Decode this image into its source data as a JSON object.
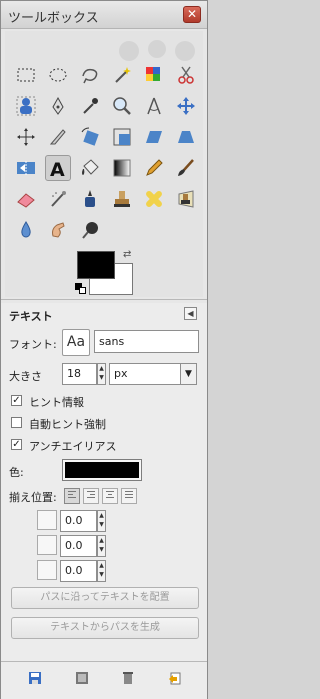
{
  "window": {
    "title": "ツールボックス",
    "close_icon": "close-icon"
  },
  "toolbox": {
    "tools": [
      {
        "name": "rect-select-tool",
        "icon": "rect-select-icon"
      },
      {
        "name": "ellipse-select-tool",
        "icon": "ellipse-select-icon"
      },
      {
        "name": "free-select-tool",
        "icon": "lasso-icon"
      },
      {
        "name": "fuzzy-select-tool",
        "icon": "magic-wand-icon"
      },
      {
        "name": "by-color-select-tool",
        "icon": "color-select-icon"
      },
      {
        "name": "scissors-select-tool",
        "icon": "scissors-icon"
      },
      {
        "name": "foreground-select-tool",
        "icon": "foreground-select-icon"
      },
      {
        "name": "paths-tool",
        "icon": "pen-path-icon"
      },
      {
        "name": "color-picker-tool",
        "icon": "eyedropper-icon"
      },
      {
        "name": "zoom-tool",
        "icon": "magnifier-icon"
      },
      {
        "name": "measure-tool",
        "icon": "compass-icon"
      },
      {
        "name": "move-tool",
        "icon": "move-arrows-icon"
      },
      {
        "name": "align-tool",
        "icon": "align-icon"
      },
      {
        "name": "crop-tool",
        "icon": "crop-knife-icon"
      },
      {
        "name": "rotate-tool",
        "icon": "rotate-icon"
      },
      {
        "name": "scale-tool",
        "icon": "scale-icon"
      },
      {
        "name": "shear-tool",
        "icon": "shear-icon"
      },
      {
        "name": "perspective-tool",
        "icon": "perspective-icon"
      },
      {
        "name": "flip-tool",
        "icon": "flip-icon"
      },
      {
        "name": "text-tool",
        "icon": "text-a-icon"
      },
      {
        "name": "bucket-fill-tool",
        "icon": "bucket-icon"
      },
      {
        "name": "blend-tool",
        "icon": "gradient-icon"
      },
      {
        "name": "pencil-tool",
        "icon": "pencil-icon"
      },
      {
        "name": "paintbrush-tool",
        "icon": "brush-icon"
      },
      {
        "name": "eraser-tool",
        "icon": "eraser-icon"
      },
      {
        "name": "airbrush-tool",
        "icon": "airbrush-icon"
      },
      {
        "name": "ink-tool",
        "icon": "ink-icon"
      },
      {
        "name": "clone-tool",
        "icon": "clone-stamp-icon"
      },
      {
        "name": "heal-tool",
        "icon": "bandage-icon"
      },
      {
        "name": "perspective-clone-tool",
        "icon": "perspective-clone-icon"
      },
      {
        "name": "blur-tool",
        "icon": "water-drop-icon"
      },
      {
        "name": "smudge-tool",
        "icon": "finger-smudge-icon"
      },
      {
        "name": "dodge-burn-tool",
        "icon": "dodge-burn-icon"
      }
    ],
    "colors": {
      "foreground": "#000000",
      "background": "#ffffff"
    }
  },
  "tool_options": {
    "title": "テキスト",
    "font_label": "フォント:",
    "font_preview": "Aa",
    "font_value": "sans",
    "size_label": "大きさ",
    "size_value": "18",
    "unit_value": "px",
    "hinting_label": "ヒント情報",
    "hinting_checked": true,
    "autohint_label": "自動ヒント強制",
    "autohint_checked": false,
    "antialias_label": "アンチエイリアス",
    "antialias_checked": true,
    "color_label": "色:",
    "color_value": "#000000",
    "justify_label": "揃え位置:",
    "indent_value": "0.0",
    "line_spacing_value": "0.0",
    "letter_spacing_value": "0.0",
    "path_button": "パスに沿ってテキストを配置",
    "text_to_path_button": "テキストからパスを生成"
  },
  "bottom_icons": [
    "save-icon",
    "restore-icon",
    "delete-icon",
    "reset-icon"
  ]
}
